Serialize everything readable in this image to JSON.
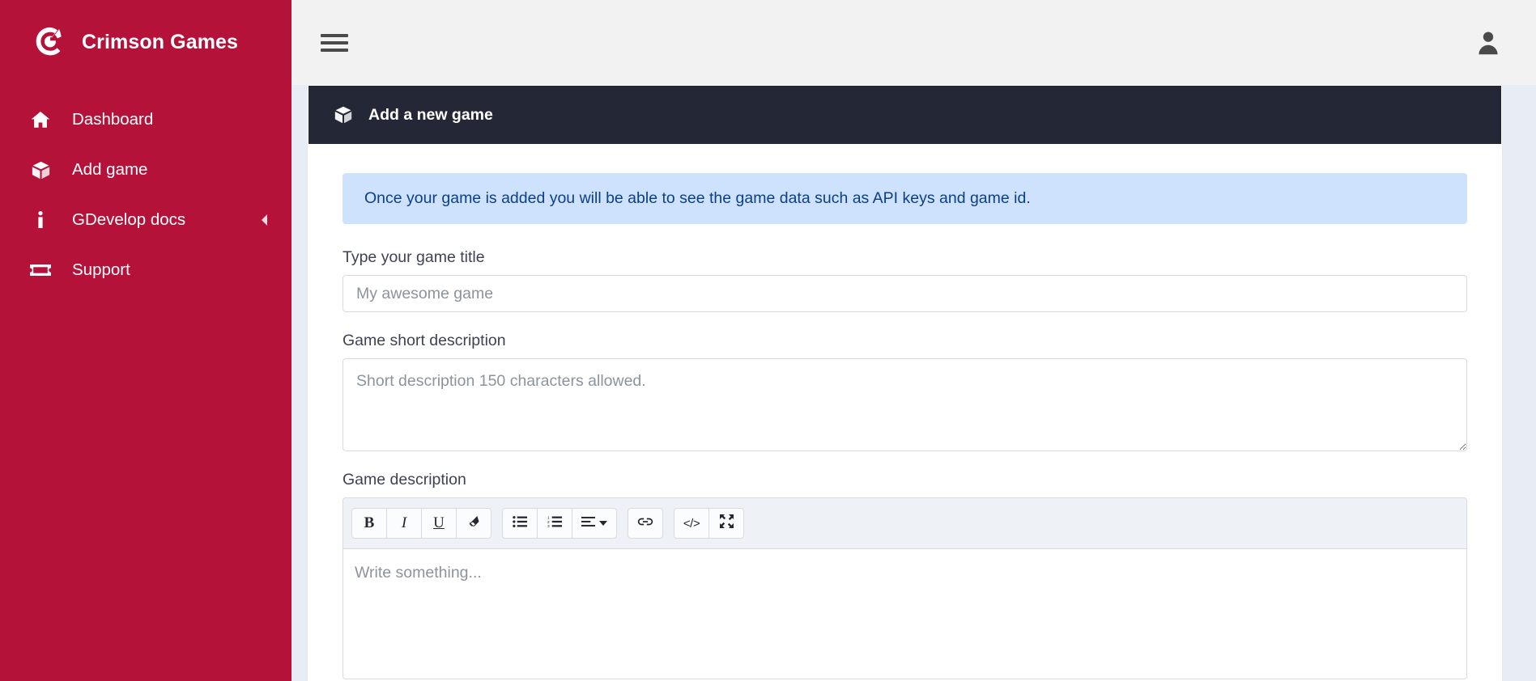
{
  "sidebar": {
    "brand": {
      "name": "Crimson Games",
      "logo_icon": "crimson-g-logo"
    },
    "items": [
      {
        "label": "Dashboard",
        "icon": "home-icon",
        "caret": ""
      },
      {
        "label": "Add game",
        "icon": "cube-icon",
        "caret": ""
      },
      {
        "label": "GDevelop docs",
        "icon": "info-icon",
        "caret": "chevron-left-icon"
      },
      {
        "label": "Support",
        "icon": "ticket-icon",
        "caret": ""
      }
    ],
    "background_color": "#b5123a"
  },
  "topbar": {
    "menu_toggle_icon": "hamburger-menu-icon",
    "user_icon": "user-account-icon",
    "background_color": "#f2f2f2"
  },
  "card": {
    "header": {
      "icon": "cube-icon",
      "title": "Add a new game",
      "background_color": "#242736"
    },
    "alert": {
      "text": "Once your game is added you will be able to see the game data such as API keys and game id.",
      "background_color": "#cfe2fd",
      "text_color": "#0b3f86"
    },
    "fields": {
      "title": {
        "label": "Type your game title",
        "placeholder": "My awesome game",
        "value": ""
      },
      "short_description": {
        "label": "Game short description",
        "placeholder": "Short description 150 characters allowed.",
        "value": ""
      },
      "description": {
        "label": "Game description",
        "placeholder": "Write something..."
      }
    },
    "editor_toolbar": {
      "groups": [
        {
          "buttons": [
            {
              "name": "bold-button",
              "glyph": "B",
              "icon": "bold-icon"
            },
            {
              "name": "italic-button",
              "glyph": "I",
              "icon": "italic-icon"
            },
            {
              "name": "underline-button",
              "glyph": "U",
              "icon": "underline-icon"
            },
            {
              "name": "remove-format-button",
              "glyph": "",
              "icon": "eraser-icon"
            }
          ]
        },
        {
          "buttons": [
            {
              "name": "unordered-list-button",
              "glyph": "",
              "icon": "bullet-list-icon"
            },
            {
              "name": "ordered-list-button",
              "glyph": "",
              "icon": "numbered-list-icon"
            },
            {
              "name": "align-button",
              "glyph": "",
              "icon": "align-left-icon"
            }
          ]
        },
        {
          "buttons": [
            {
              "name": "link-button",
              "glyph": "",
              "icon": "link-icon"
            }
          ]
        },
        {
          "buttons": [
            {
              "name": "code-view-button",
              "glyph": "</>",
              "icon": "code-icon"
            },
            {
              "name": "fullscreen-button",
              "glyph": "",
              "icon": "fullscreen-icon"
            }
          ]
        }
      ]
    }
  },
  "page": {
    "background_color": "#e8ecf5"
  }
}
